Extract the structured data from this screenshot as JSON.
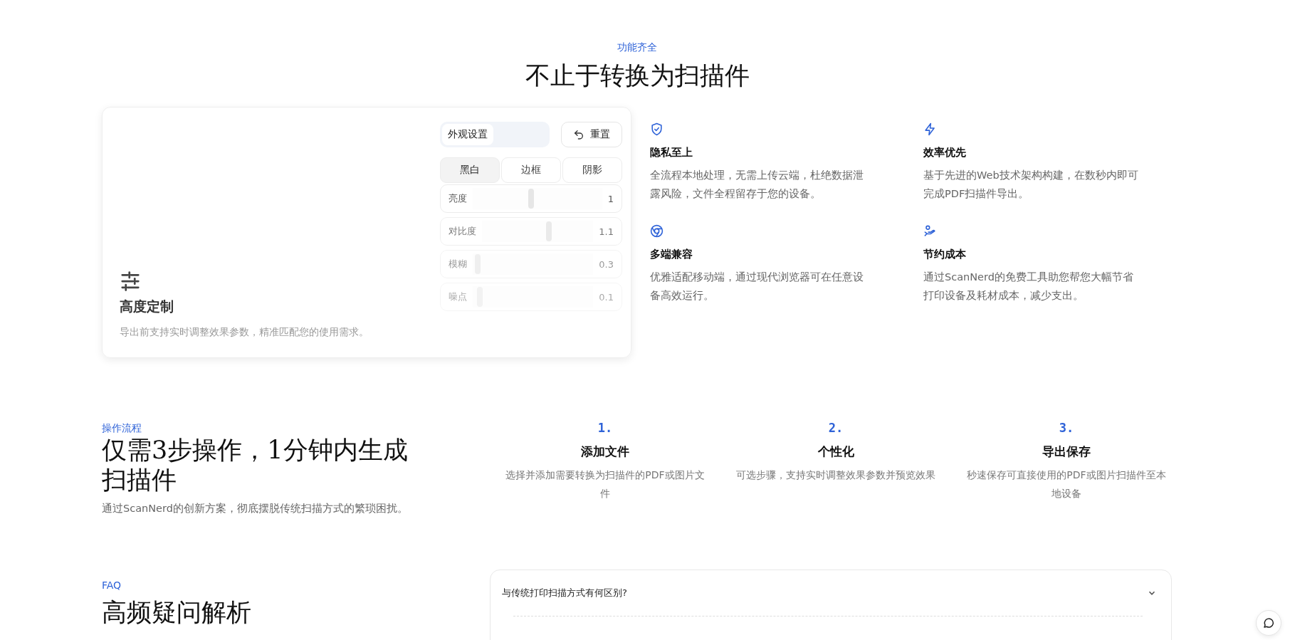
{
  "features_section": {
    "eyebrow": "功能齐全",
    "heading": "不止于转换为扫描件",
    "showcase": {
      "segments": [
        {
          "label": "外观设置",
          "selected": true
        }
      ],
      "reset_button": "重置",
      "modes": [
        {
          "label": "黑白",
          "selected": true
        },
        {
          "label": "边框",
          "selected": false
        },
        {
          "label": "阴影",
          "selected": false
        }
      ],
      "sliders": [
        {
          "label": "亮度",
          "level": 0.45,
          "reading": "1"
        },
        {
          "label": "对比度",
          "level": 0.6,
          "reading": "1.1"
        },
        {
          "label": "模糊",
          "level": 0.04,
          "reading": "0.3"
        },
        {
          "label": "噪点",
          "level": 0.06,
          "reading": "0.1"
        }
      ],
      "title": "高度定制",
      "description": "导出前支持实时调整效果参数，精准匹配您的使用需求。"
    },
    "features": [
      {
        "kind": "shield",
        "title": "隐私至上",
        "description": "全流程本地处理，无需上传云端，杜绝数据泄露风险，文件全程留存于您的设备。"
      },
      {
        "kind": "bolt",
        "title": "效率优先",
        "description": "基于先进的Web技术架构构建，在数秒内即可完成PDF扫描件导出。"
      },
      {
        "kind": "browser",
        "title": "多端兼容",
        "description": "优雅适配移动端，通过现代浏览器可在任意设备高效运行。"
      },
      {
        "kind": "savings",
        "title": "节约成本",
        "description": "通过ScanNerd的免费工具助您帮您大幅节省打印设备及耗材成本，减少支出。"
      }
    ]
  },
  "steps_section": {
    "eyebrow": "操作流程",
    "heading": "仅需3步操作，1分钟内生成扫描件",
    "subtitle": "通过ScanNerd的创新方案，彻底摆脱传统扫描方式的繁琐困扰。",
    "steps": [
      {
        "number": "1.",
        "title": "添加文件",
        "description": "选择并添加需要转换为扫描件的PDF或图片文件"
      },
      {
        "number": "2.",
        "title": "个性化",
        "description": "可选步骤，支持实时调整效果参数并预览效果"
      },
      {
        "number": "3.",
        "title": "导出保存",
        "description": "秒速保存可直接使用的PDF或图片扫描件至本地设备"
      }
    ]
  },
  "faq_section": {
    "eyebrow": "FAQ",
    "heading": "高频疑问解析",
    "questions": [
      {
        "question": "与传统打印扫描方式有何区别?",
        "expanded": true
      }
    ]
  }
}
